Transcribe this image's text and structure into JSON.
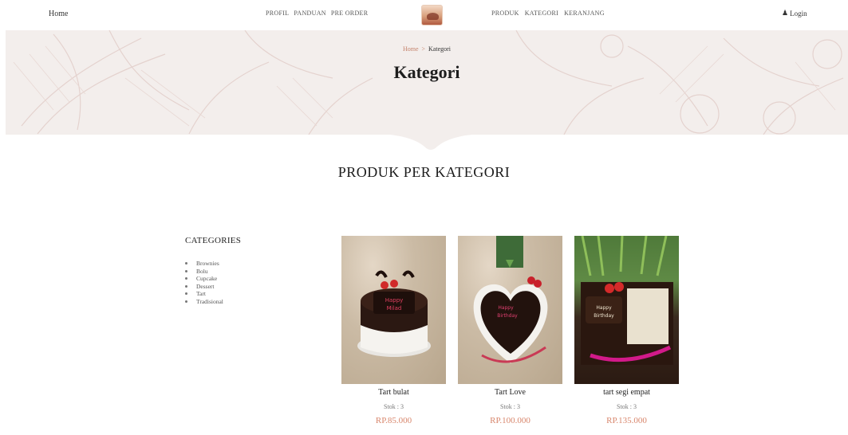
{
  "nav": {
    "home": "Home",
    "left_links": [
      "PROFIL",
      "PANDUAN",
      "PRE ORDER"
    ],
    "right_links": [
      "PRODUK",
      "KATEGORI",
      "KERANJANG"
    ],
    "login": "Login",
    "icons": {
      "user": "user-icon",
      "logo": "logo-image"
    }
  },
  "hero": {
    "breadcrumb_home": "Home",
    "breadcrumb_sep": ">",
    "breadcrumb_current": "Kategori",
    "title": "Kategori"
  },
  "section_title": "PRODUK PER KATEGORI",
  "categories": {
    "title": "CATEGORIES",
    "items": [
      "Brownies",
      "Bolu",
      "Cupcake",
      "Dessert",
      "Tart",
      "Tradisional"
    ]
  },
  "products": [
    {
      "name": "Tart bulat",
      "stock": "Stok : 3",
      "price": "RP.85.000"
    },
    {
      "name": "Tart Love",
      "stock": "Stok : 3",
      "price": "RP.100.000"
    },
    {
      "name": "tart segi empat",
      "stock": "Stok : 3",
      "price": "RP.135.000"
    }
  ],
  "colors": {
    "accent": "#d8866c",
    "hero_bg": "#f3eeec",
    "text": "#222222"
  }
}
